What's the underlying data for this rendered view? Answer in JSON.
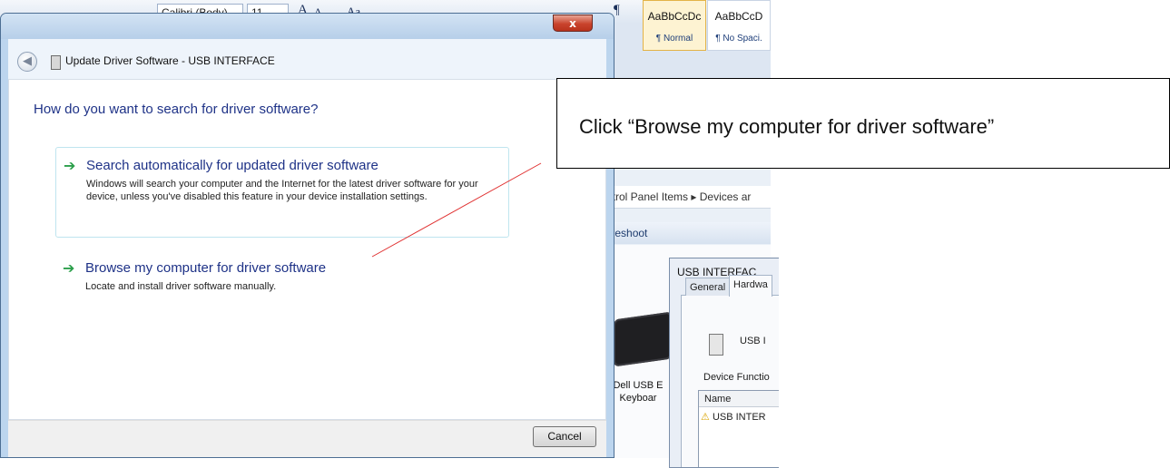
{
  "ribbon": {
    "font_name": "Calibri (Body)",
    "font_size": "11",
    "glyphs": [
      "A",
      "A",
      "Aa",
      "¶"
    ],
    "styles": [
      {
        "preview": "AaBbCcDc",
        "name": "¶ Normal"
      },
      {
        "preview": "AaBbCcD",
        "name": "¶ No Spaci."
      }
    ]
  },
  "explorer": {
    "breadcrumb": "ntrol Panel Items ▸ Devices ar",
    "toolbar_label": "bleshoot",
    "keyboard_label": "Dell USB E\nKeyboar"
  },
  "properties": {
    "title": "USB INTERFAC",
    "tabs": [
      "General",
      "Hardwa"
    ],
    "device_name": "USB I",
    "device_functions_label": "Device Functio",
    "list_header": "Name",
    "list_row": "USB INTER"
  },
  "dialog": {
    "title": "Update Driver Software - USB INTERFACE",
    "close_label": "x",
    "question": "How do you want to search for driver software?",
    "options": [
      {
        "title": "Search automatically for updated driver software",
        "description": "Windows will search your computer and the Internet for the latest driver software for your device, unless you've disabled this feature in your device installation settings."
      },
      {
        "title": "Browse my computer for driver software",
        "description": "Locate and install driver software manually."
      }
    ],
    "cancel_label": "Cancel"
  },
  "annotation": {
    "callout_text": "Click “Browse my computer for driver software”"
  },
  "colors": {
    "link_blue": "#1e3287",
    "arrow_green": "#2c9f4b",
    "pointer_red": "#e03030"
  }
}
